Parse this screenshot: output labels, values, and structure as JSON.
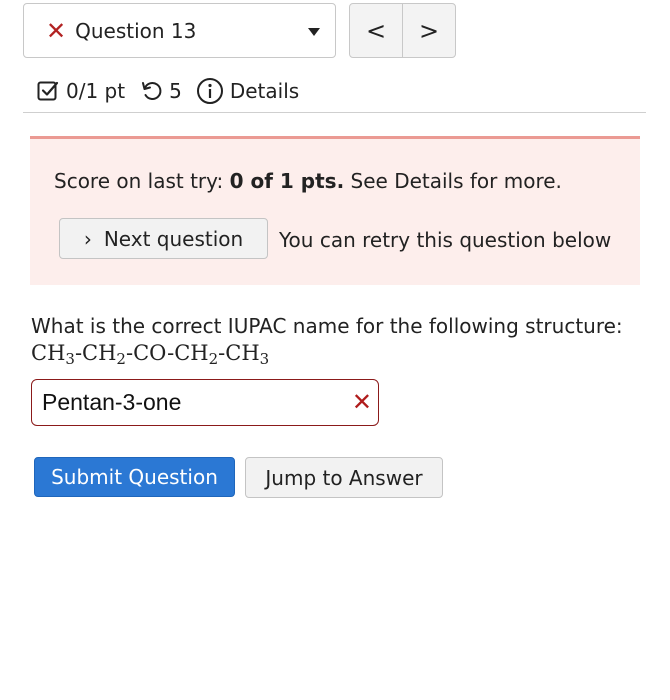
{
  "question_selector": {
    "status_icon": "x-mark",
    "label": "Question 13",
    "status_color": "#b22222"
  },
  "nav": {
    "prev_label": "<",
    "next_label": ">"
  },
  "stats": {
    "score": "0/1 pt",
    "retries": "5",
    "details_label": "Details"
  },
  "feedback": {
    "score_prefix": "Score on last try: ",
    "score_value": "0 of 1 pts.",
    "score_suffix": " See Details for more.",
    "next_question_label": "Next question",
    "retry_text": "You can retry this question below",
    "background_color": "#fdeeec",
    "accent_color": "#eb9a93"
  },
  "question": {
    "prompt": "What is the correct IUPAC name for the following structure:",
    "formula_parts": {
      "p1": "CH",
      "s1": "3",
      "p2": "-CH",
      "s2": "2",
      "p3": "-CO-CH",
      "s3": "2",
      "p4": "-CH",
      "s4": "3"
    }
  },
  "answer": {
    "value": "Pentan-3-one",
    "status": "incorrect",
    "status_mark": "✕"
  },
  "actions": {
    "submit_label": "Submit Question",
    "jump_label": "Jump to Answer",
    "submit_color": "#2b78d4"
  }
}
